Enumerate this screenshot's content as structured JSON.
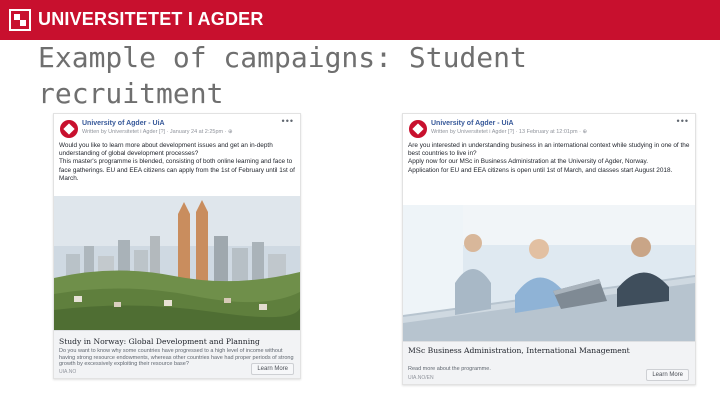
{
  "header": {
    "brand": "UNIVERSITETET I AGDER",
    "logo_icon": "uia-logo-icon",
    "bar_color": "#c8102e"
  },
  "slide": {
    "title": "Example of campaigns: Student recruitment"
  },
  "posts": [
    {
      "page_name": "University of Agder - UiA",
      "written_by": "Written by Universitetet i Agder [?] · January 24 at 2:25pm · ",
      "menu_icon": "more-options-icon",
      "text": [
        "Would you like to learn more about development issues and get an in-depth understanding of global development processes?",
        "This master's programme is blended, consisting of both online learning and face to face gatherings. EU and EEA citizens can apply from the 1st of February until 1st of March."
      ],
      "image": "city-skyline-photo",
      "link_title": "Study in Norway: Global Development and Planning",
      "link_desc": "Do you want to know why some countries have progressed to a high level of income without having strong resource endowments, whereas other countries have had proper periods of strong growth by excessively exploiting their resource base?",
      "link_domain": "UIA.NO",
      "button": "Learn More"
    },
    {
      "page_name": "University of Agder - UiA",
      "written_by": "Written by Universitetet i Agder [?] · 13 February at 12:01pm · ",
      "menu_icon": "more-options-icon",
      "text": [
        "Are you interested in understanding business in an international context while studying in one of the best countries to live in?",
        "Apply now for our MSc in Business Administration at the University of Agder, Norway.",
        "Application for EU and EEA citizens is open until 1st of March, and classes start August 2018."
      ],
      "image": "students-laptop-photo",
      "link_title": "MSc Business Administration, International Management",
      "link_desc": "Read more about the programme.",
      "link_domain": "UIA.NO/EN",
      "button": "Learn More"
    }
  ]
}
